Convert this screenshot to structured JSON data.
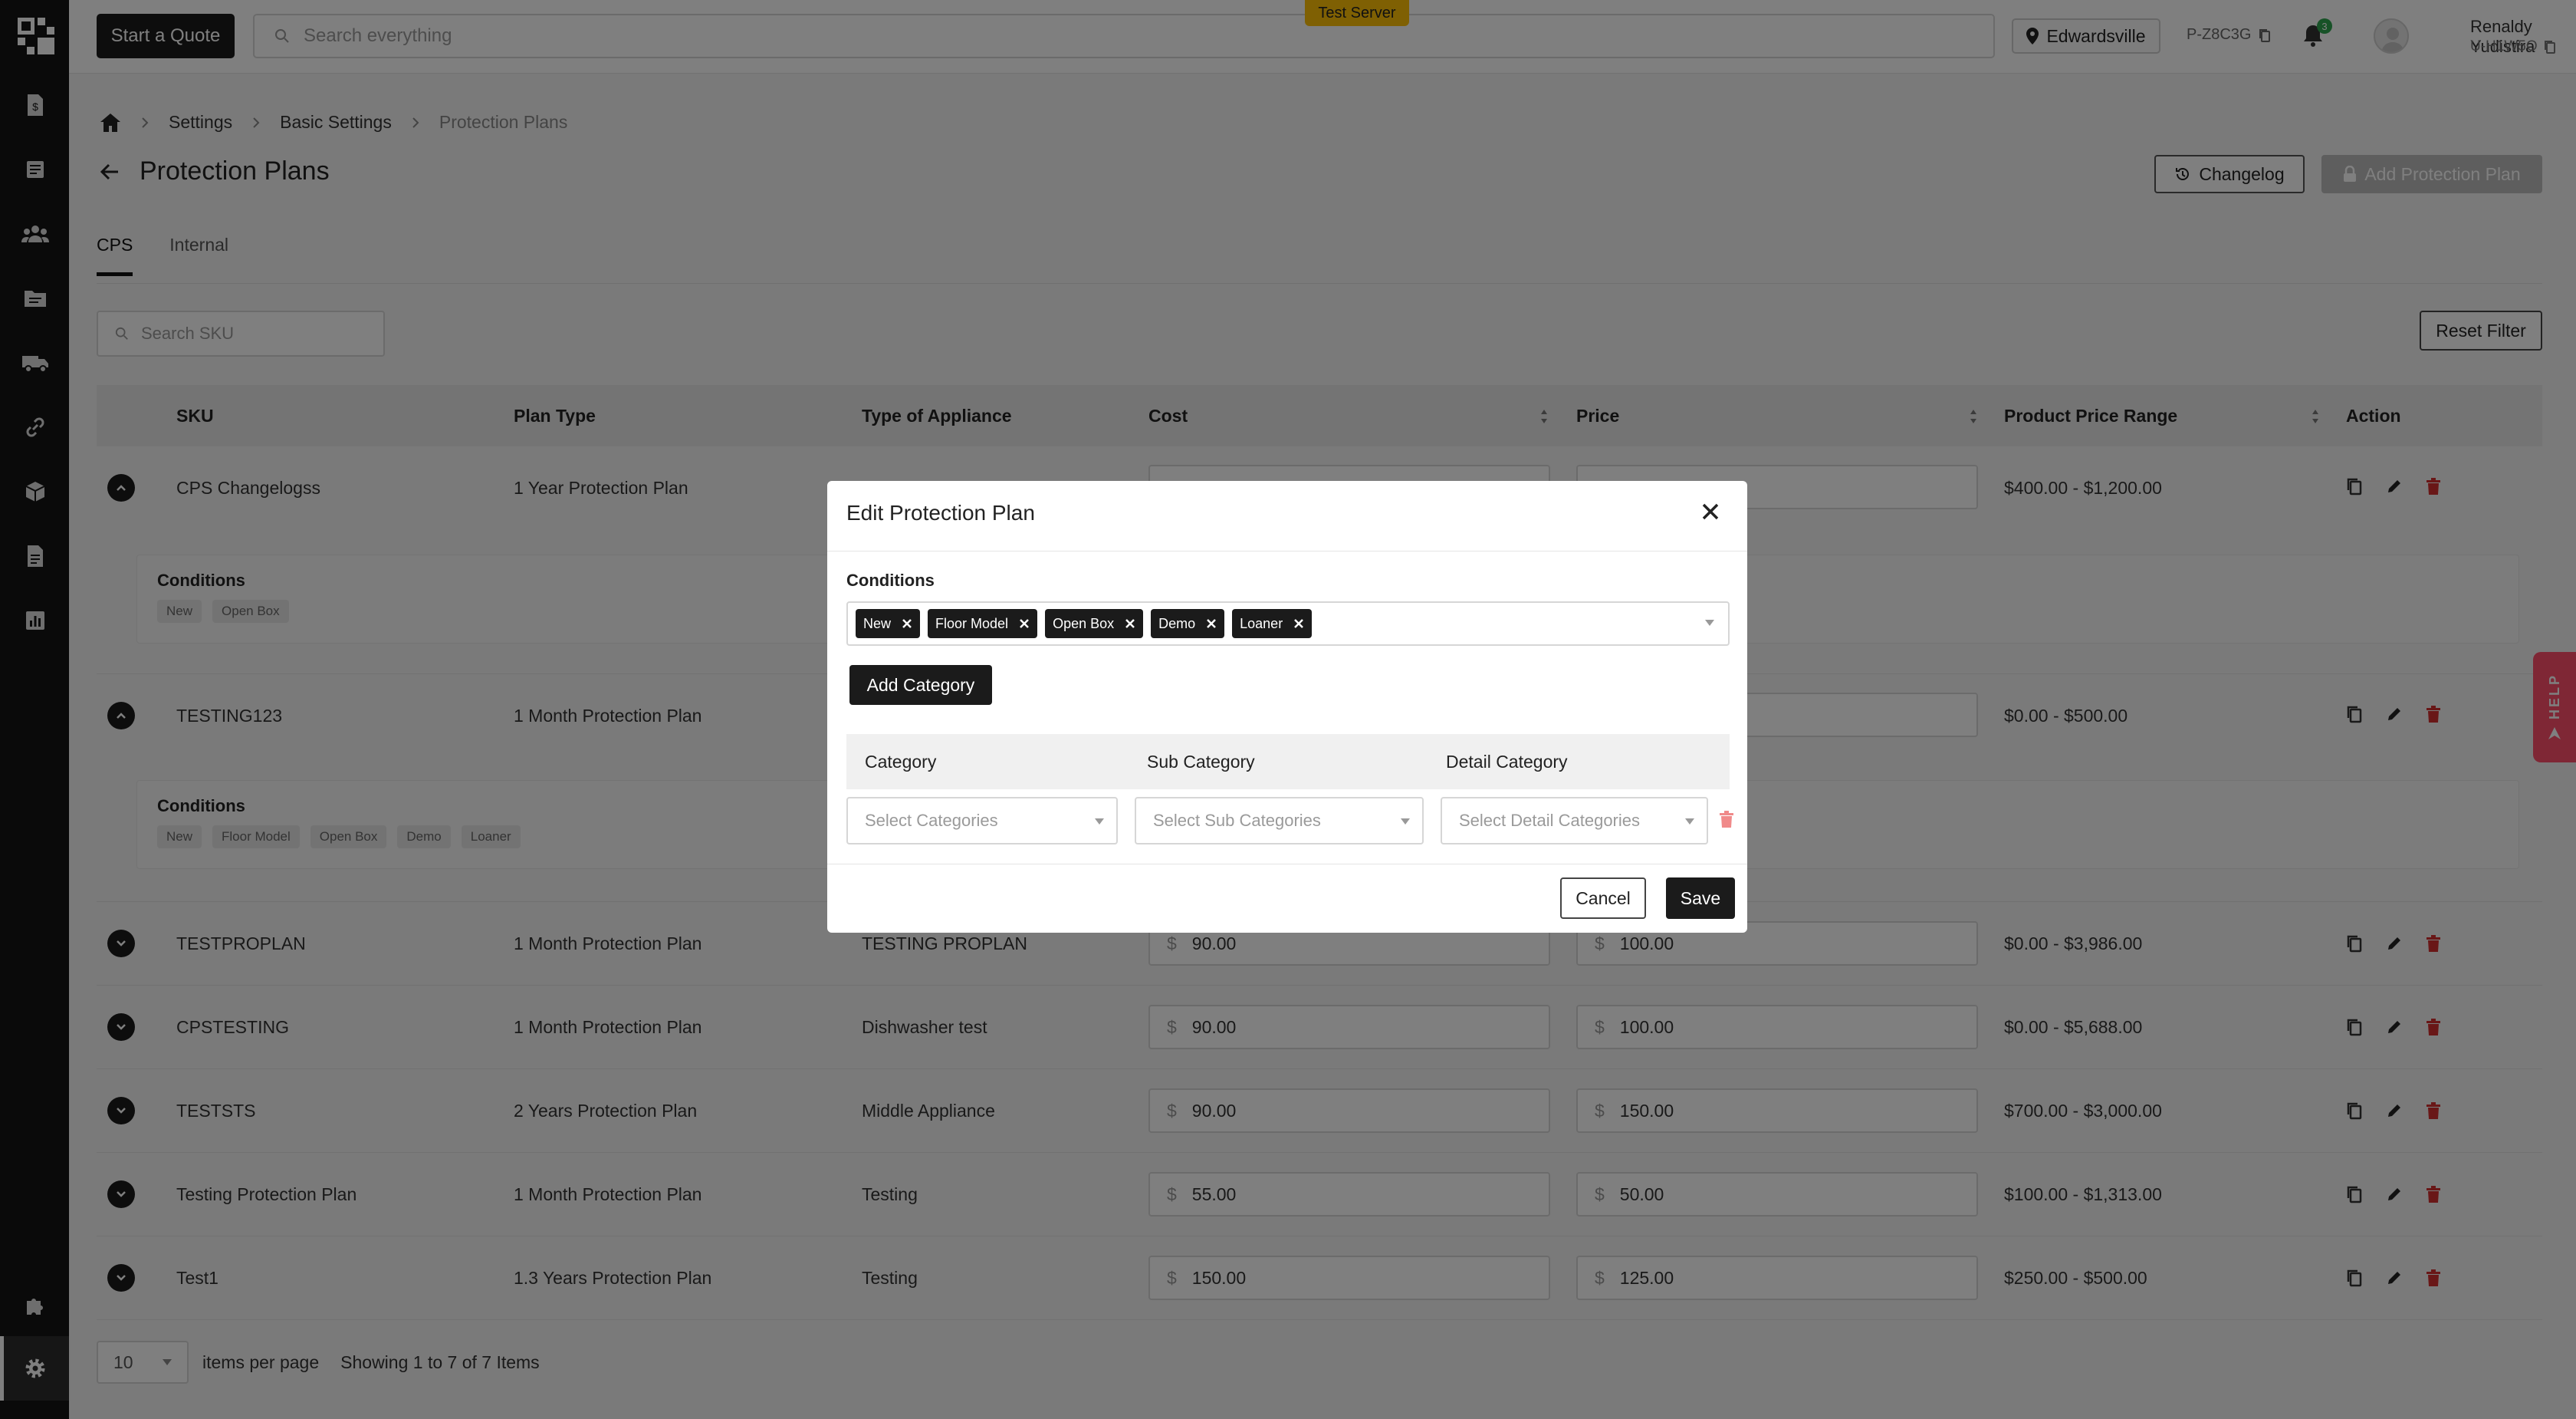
{
  "header": {
    "start_quote": "Start a Quote",
    "search_placeholder": "Search everything",
    "server_badge": "Test Server",
    "location": "Edwardsville",
    "code": "P-Z8C3G",
    "notifications": "3",
    "user_name": "Renaldy Yudistira",
    "user_code": "U-H1W5O"
  },
  "breadcrumb": [
    "Settings",
    "Basic Settings",
    "Protection Plans"
  ],
  "page": {
    "title": "Protection Plans",
    "changelog": "Changelog",
    "add_plan": "Add Protection Plan",
    "tabs": [
      "CPS",
      "Internal"
    ],
    "search_sku_placeholder": "Search SKU",
    "reset_filter": "Reset Filter"
  },
  "table": {
    "headers": [
      "SKU",
      "Plan Type",
      "Type of Appliance",
      "Cost",
      "Price",
      "Product Price Range",
      "Action"
    ],
    "currency": "$",
    "conditions_label": "Conditions",
    "rows": [
      {
        "sku": "CPS Changelogss",
        "plan": "1 Year Protection Plan",
        "appliance": "",
        "cost": "",
        "price": "",
        "range": "$400.00 - $1,200.00",
        "conditions": [
          "New",
          "Open Box"
        ]
      },
      {
        "sku": "TESTING123",
        "plan": "1 Month Protection Plan",
        "appliance": "",
        "cost": "",
        "price": "",
        "range": "$0.00 - $500.00",
        "conditions": [
          "New",
          "Floor Model",
          "Open Box",
          "Demo",
          "Loaner"
        ]
      },
      {
        "sku": "TESTPROPLAN",
        "plan": "1 Month Protection Plan",
        "appliance": "TESTING PROPLAN",
        "cost": "90.00",
        "price": "100.00",
        "range": "$0.00 - $3,986.00"
      },
      {
        "sku": "CPSTESTING",
        "plan": "1 Month Protection Plan",
        "appliance": "Dishwasher test",
        "cost": "90.00",
        "price": "100.00",
        "range": "$0.00 - $5,688.00"
      },
      {
        "sku": "TESTSTS",
        "plan": "2 Years Protection Plan",
        "appliance": "Middle Appliance",
        "cost": "90.00",
        "price": "150.00",
        "range": "$700.00 - $3,000.00"
      },
      {
        "sku": "Testing Protection Plan",
        "plan": "1 Month Protection Plan",
        "appliance": "Testing",
        "cost": "55.00",
        "price": "50.00",
        "range": "$100.00 - $1,313.00"
      },
      {
        "sku": "Test1",
        "plan": "1.3 Years Protection Plan",
        "appliance": "Testing",
        "cost": "150.00",
        "price": "125.00",
        "range": "$250.00 - $500.00"
      }
    ]
  },
  "pagination": {
    "per_page": "10",
    "per_page_label": "items per page",
    "showing": "Showing 1 to 7 of 7 Items"
  },
  "help": "HELP",
  "modal": {
    "title": "Edit Protection Plan",
    "conditions_label": "Conditions",
    "chips": [
      "New",
      "Floor Model",
      "Open Box",
      "Demo",
      "Loaner"
    ],
    "add_category": "Add Category",
    "col_category": "Category",
    "col_sub": "Sub Category",
    "col_detail": "Detail Category",
    "ph_category": "Select Categories",
    "ph_sub": "Select Sub Categories",
    "ph_detail": "Select Detail Categories",
    "cancel": "Cancel",
    "save": "Save"
  }
}
